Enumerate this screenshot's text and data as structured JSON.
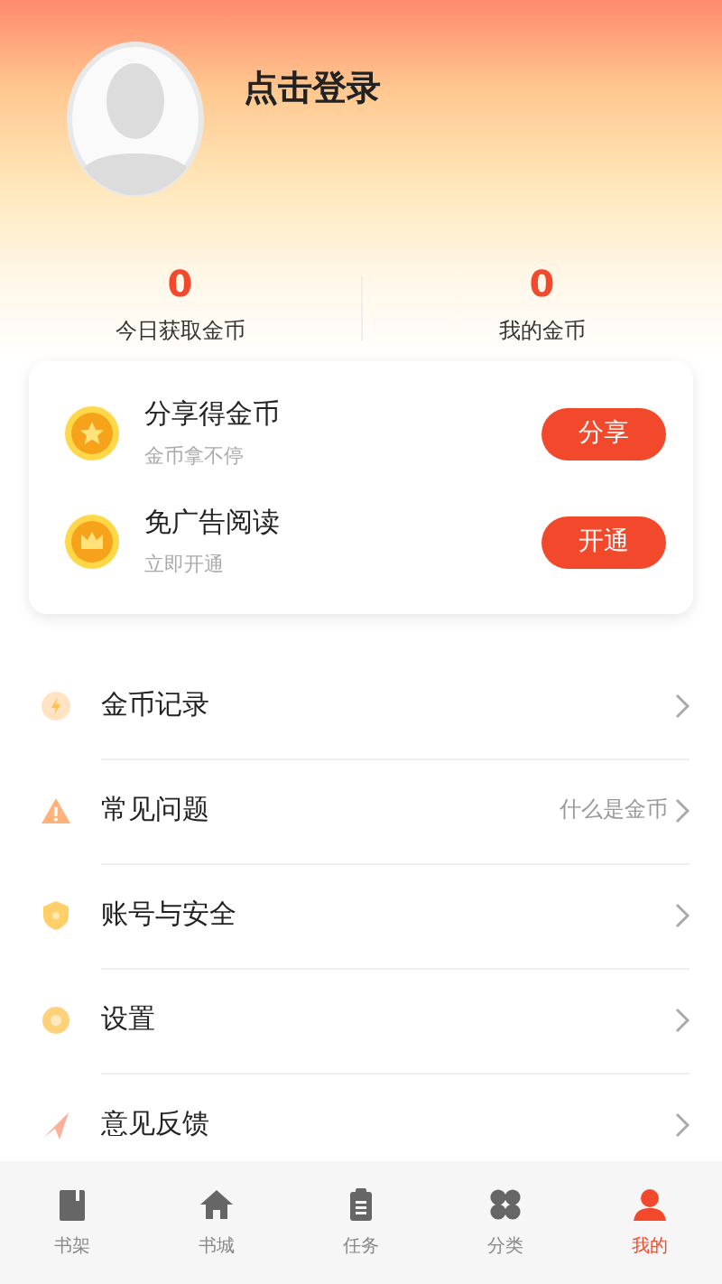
{
  "profile": {
    "login_text": "点击登录"
  },
  "stats": [
    {
      "value": "0",
      "label": "今日获取金币"
    },
    {
      "value": "0",
      "label": "我的金币"
    }
  ],
  "promos": [
    {
      "kind": "star",
      "title": "分享得金币",
      "subtitle": "金币拿不停",
      "button": "分享"
    },
    {
      "kind": "crown",
      "title": "免广告阅读",
      "subtitle": "立即开通",
      "button": "开通"
    }
  ],
  "menu": [
    {
      "kind": "coin",
      "label": "金币记录"
    },
    {
      "kind": "warning",
      "label": "常见问题",
      "hint": "什么是金币"
    },
    {
      "kind": "shield",
      "label": "账号与安全"
    },
    {
      "kind": "gear",
      "label": "设置"
    },
    {
      "kind": "send",
      "label": "意见反馈"
    }
  ],
  "tabs": [
    {
      "kind": "book",
      "label": "书架",
      "selected": false
    },
    {
      "kind": "home",
      "label": "书城",
      "selected": false
    },
    {
      "kind": "task",
      "label": "任务",
      "selected": false
    },
    {
      "kind": "grid",
      "label": "分类",
      "selected": false
    },
    {
      "kind": "person",
      "label": "我的",
      "selected": true
    }
  ]
}
